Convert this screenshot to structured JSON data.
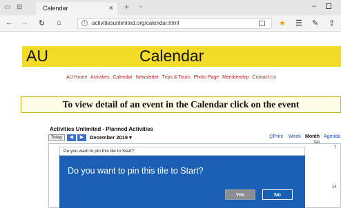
{
  "browser": {
    "tab_title": "Calendar",
    "tab_close_icon": "×",
    "new_tab_icon": "+",
    "tab_list_icon": "⌄",
    "url": "activitiesunlimited.org/calendar.html",
    "nav_icons": {
      "back": "←",
      "forward": "→",
      "refresh": "↻",
      "home": "⌂"
    },
    "toolbar_icons": {
      "favorite": "★",
      "favorites_hub": "☰",
      "notes": "✎",
      "share": "⇪"
    },
    "window_icons": {
      "minimize": "–"
    }
  },
  "site": {
    "logo_left": "AU",
    "logo_right": "Calendar",
    "nav_links": [
      "AU Home",
      "Activities",
      "Calendar",
      "Newsletter",
      "Trips & Tours",
      "Photo Page",
      "Membership",
      "Contact Us"
    ],
    "instruction": "To view detail of an event in the Calendar click on the event"
  },
  "calendar": {
    "title": "Activities Unlimited - Planned Activities",
    "today_label": "Today",
    "prev_icon": "◀",
    "next_icon": "▶",
    "month": "December 2019",
    "month_dropdown_icon": "▾",
    "print_label": "Print",
    "views": {
      "week": "Week",
      "month": "Month",
      "agenda": "Agenda"
    },
    "sat_header": "Sat",
    "day_numbers": {
      "first": "7",
      "second": "14"
    }
  },
  "dialog": {
    "header": "Do you want to pin this tile to Start?",
    "message": "Do you want to pin this tile to Start?",
    "yes_label": "Yes",
    "no_label": "No"
  },
  "colors": {
    "banner": "#f2dc28",
    "dialog_bg": "#1a5fb4",
    "nav_link": "#b22222",
    "yes_button": "#8a8e92"
  }
}
